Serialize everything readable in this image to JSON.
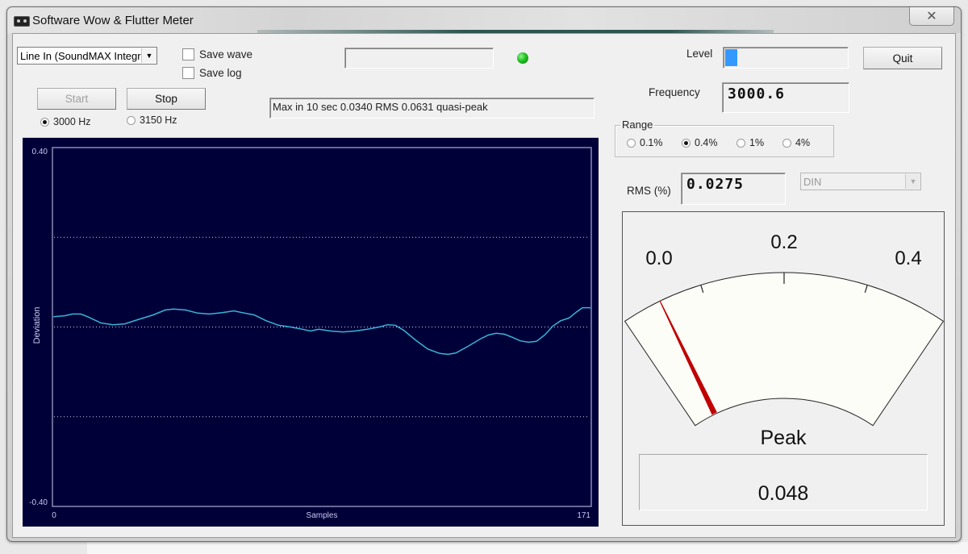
{
  "window": {
    "title": "Software Wow & Flutter Meter",
    "close_label": "✕"
  },
  "input_device": {
    "selected": "Line In (SoundMAX Integra"
  },
  "options": {
    "save_wave_label": "Save wave",
    "save_wave_checked": false,
    "save_log_label": "Save log",
    "save_log_checked": false
  },
  "controls": {
    "start_label": "Start",
    "start_enabled": false,
    "stop_label": "Stop",
    "quit_label": "Quit"
  },
  "reference_frequency": {
    "options": [
      "3000 Hz",
      "3150 Hz"
    ],
    "selected": "3000 Hz"
  },
  "status": {
    "top_field": "",
    "indicator_color": "#22c022",
    "message": "Max in 10 sec 0.0340 RMS 0.0631 quasi-peak"
  },
  "level": {
    "label": "Level",
    "fraction": 0.1,
    "bar_color": "#3399ff"
  },
  "frequency": {
    "label": "Frequency",
    "value": "3000.6"
  },
  "range": {
    "label": "Range",
    "options": [
      "0.1%",
      "0.4%",
      "1%",
      "4%"
    ],
    "selected": "0.4%"
  },
  "rms": {
    "label": "RMS (%)",
    "value": "0.0275",
    "weighting": "DIN"
  },
  "meter": {
    "scale_labels": [
      "0.0",
      "0.2",
      "0.4"
    ],
    "min": 0.0,
    "max": 0.4,
    "needle_value": 0.048,
    "needle_color": "#c00000",
    "caption": "Peak",
    "readout": "0.048"
  },
  "chart_data": {
    "type": "line",
    "title": "",
    "xlabel": "Samples",
    "ylabel": "Deviation",
    "xlim": [
      0,
      171
    ],
    "ylim": [
      -0.4,
      0.4
    ],
    "x_tick_labels": [
      "0",
      "171"
    ],
    "y_tick_labels": [
      "0.40",
      "-0.40"
    ],
    "gridlines_y": [
      0.2,
      0.0,
      -0.2
    ],
    "grid": true,
    "background": "#000038",
    "line_color": "#38b4d8",
    "series": [
      {
        "name": "deviation",
        "x": [
          0.3,
          3.8,
          6.4,
          9.0,
          11.5,
          15.4,
          19.2,
          23.0,
          26.9,
          32.0,
          35.8,
          38.4,
          42.2,
          46.1,
          49.9,
          53.8,
          57.6,
          60.2,
          64.0,
          67.8,
          71.7,
          75.5,
          79.4,
          81.9,
          84.5,
          88.3,
          92.2,
          96.0,
          99.9,
          103.7,
          106.3,
          108.8,
          111.4,
          115.2,
          119.1,
          122.9,
          125.5,
          128.0,
          131.9,
          135.7,
          138.3,
          140.8,
          143.4,
          146.0,
          148.5,
          151.1,
          153.6,
          156.2,
          158.8,
          161.3,
          163.9,
          166.4,
          168.2,
          170.8
        ],
        "y": [
          0.023,
          0.025,
          0.029,
          0.029,
          0.022,
          0.009,
          0.005,
          0.007,
          0.016,
          0.027,
          0.038,
          0.04,
          0.038,
          0.031,
          0.029,
          0.032,
          0.036,
          0.032,
          0.027,
          0.014,
          0.004,
          0.0,
          -0.005,
          -0.009,
          -0.005,
          -0.009,
          -0.011,
          -0.009,
          -0.005,
          0.0,
          0.005,
          0.004,
          -0.007,
          -0.029,
          -0.049,
          -0.059,
          -0.061,
          -0.058,
          -0.043,
          -0.027,
          -0.018,
          -0.014,
          -0.016,
          -0.023,
          -0.031,
          -0.034,
          -0.032,
          -0.018,
          0.002,
          0.014,
          0.02,
          0.034,
          0.043,
          0.043
        ]
      }
    ]
  }
}
